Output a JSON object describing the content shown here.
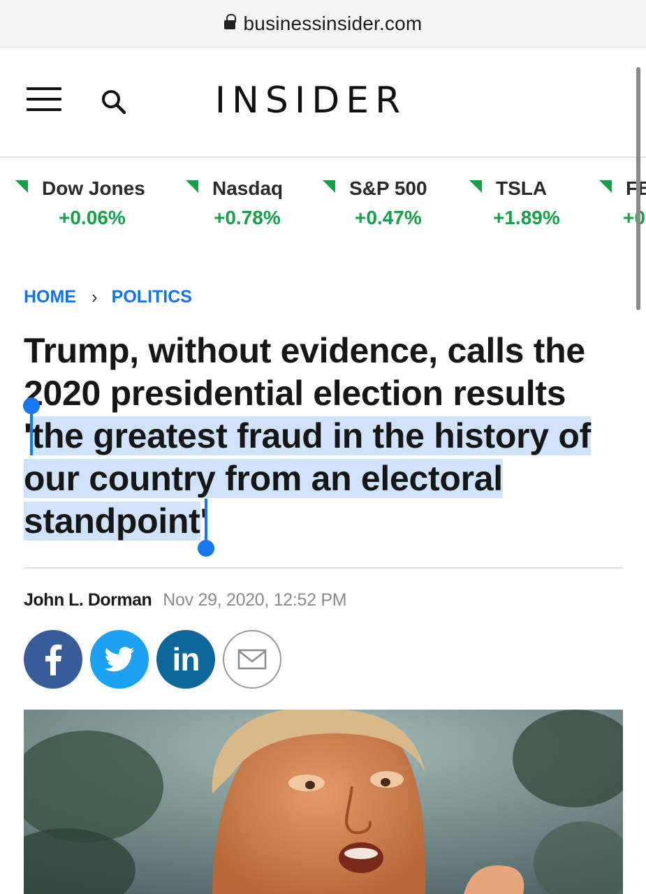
{
  "browser": {
    "url": "businessinsider.com"
  },
  "header": {
    "logo": "INSIDER"
  },
  "ticker": [
    {
      "name": "Dow Jones",
      "change": "+0.06%"
    },
    {
      "name": "Nasdaq",
      "change": "+0.78%"
    },
    {
      "name": "S&P 500",
      "change": "+0.47%"
    },
    {
      "name": "TSLA",
      "change": "+1.89%"
    },
    {
      "name": "FB",
      "change": "+0"
    }
  ],
  "breadcrumb": {
    "home": "HOME",
    "section": "POLITICS"
  },
  "article": {
    "headline_part1": "Trump, without evidence, calls the 2020 presidential election results ",
    "headline_quote_open": "'",
    "headline_selected": "the greatest fraud in the history of our country from an electoral standpoint",
    "headline_quote_close": "'",
    "author": "John L. Dorman",
    "date": "Nov 29, 2020, 12:52 PM"
  },
  "share": {
    "facebook_glyph": "f",
    "linkedin_glyph": "in"
  },
  "colors": {
    "link_blue": "#1273e6",
    "ticker_green": "#15a04a",
    "selection": "#cfe3fc",
    "selection_handle": "#1677f0"
  }
}
